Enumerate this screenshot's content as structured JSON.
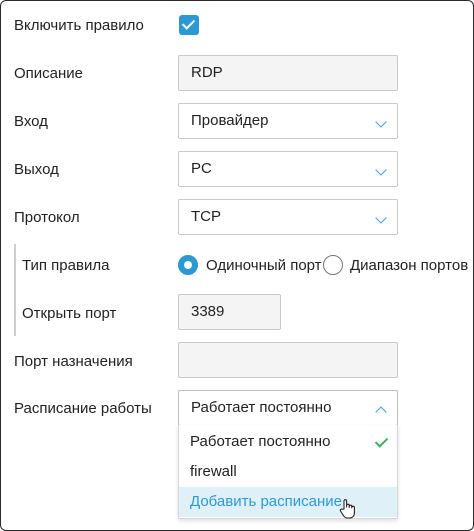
{
  "form": {
    "enable_rule": {
      "label": "Включить правило",
      "checked": true
    },
    "description": {
      "label": "Описание",
      "value": "RDP"
    },
    "input": {
      "label": "Вход",
      "value": "Провайдер"
    },
    "output": {
      "label": "Выход",
      "value": "PC"
    },
    "protocol": {
      "label": "Протокол",
      "value": "TCP"
    },
    "rule_type": {
      "label": "Тип правила",
      "options": [
        "Одиночный порт",
        "Диапазон портов"
      ],
      "selected": "Одиночный порт"
    },
    "open_port": {
      "label": "Открыть порт",
      "value": "3389"
    },
    "dest_port": {
      "label": "Порт назначения",
      "value": ""
    },
    "schedule": {
      "label": "Расписание работы",
      "value": "Работает постоянно",
      "options": [
        "Работает постоянно",
        "firewall",
        "Добавить расписание"
      ],
      "hovered": "Добавить расписание"
    }
  },
  "colors": {
    "accent": "#2b9ad4",
    "check_green": "#3bb26b",
    "hover_bg": "#dff0f8"
  },
  "icons": [
    "checkmark-icon",
    "chevron-down-icon",
    "chevron-up-icon",
    "hand-cursor-icon"
  ]
}
